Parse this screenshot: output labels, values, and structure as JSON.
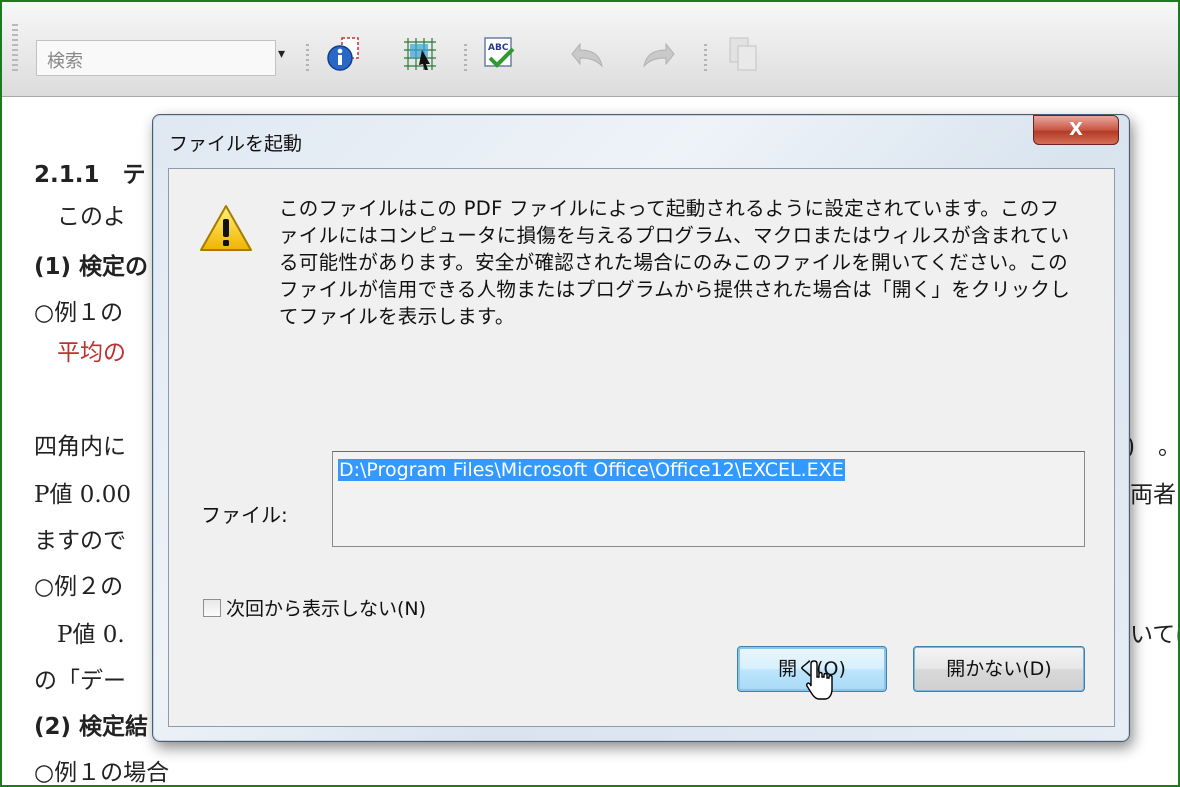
{
  "toolbar": {
    "search_placeholder": "検索",
    "icons": [
      "document-info-icon",
      "grid-select-icon",
      "spell-check-icon",
      "undo-icon",
      "redo-icon",
      "copy-icon"
    ]
  },
  "document": {
    "lines": [
      {
        "text": "2.1.1　テ"
      },
      {
        "text": "　このよ"
      },
      {
        "text": "(1) 検定の"
      },
      {
        "text": "○例１の"
      },
      {
        "text": "　平均の"
      },
      {
        "text": "四角内に"
      },
      {
        "text": "P値 0.00"
      },
      {
        "text": "ますので"
      },
      {
        "text": "○例２の"
      },
      {
        "text": "　P値 0."
      },
      {
        "text": "の「デー"
      },
      {
        "text": "(2) 検定結"
      },
      {
        "text": "○例１の場合"
      }
    ],
    "right_fragments": [
      ")　。",
      "両者",
      "いては"
    ]
  },
  "dialog": {
    "title": "ファイルを起動",
    "close_label": "X",
    "message": "このファイルはこの PDF ファイルによって起動されるように設定されています。このファイルにはコンピュータに損傷を与えるプログラム、マクロまたはウィルスが含まれている可能性があります。安全が確認された場合にのみこのファイルを開いてください。このファイルが信用できる人物またはプログラムから提供された場合は「開く」をクリックしてファイルを表示します。",
    "file_label": "ファイル:",
    "file_path": "D:\\Program Files\\Microsoft Office\\Office12\\EXCEL.EXE",
    "checkbox_label": "次回から表示しない(N)",
    "checkbox_checked": false,
    "open_button": "開く(O)",
    "dont_open_button": "開かない(D)"
  }
}
